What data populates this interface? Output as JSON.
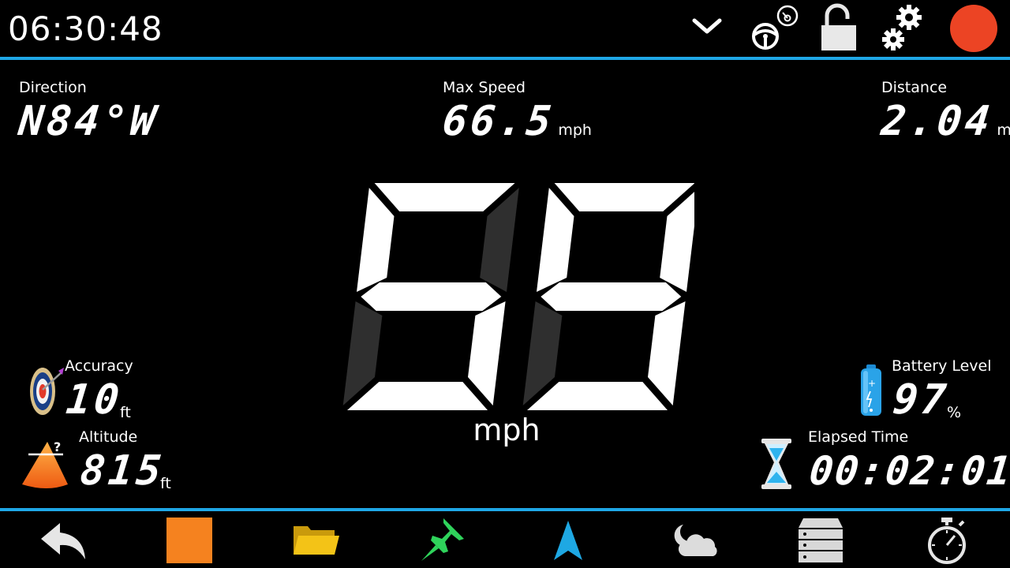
{
  "status": {
    "clock": "06:30:48"
  },
  "colors": {
    "accent": "#1fa7e6",
    "record": "#ec4424",
    "stop": "#f5821f",
    "folder": "#f3c317",
    "pin": "#2fd35b",
    "nav_arrow": "#1ea8e3",
    "dim_segment": "#2f2f2f"
  },
  "top_icons": [
    "chevron-down-icon",
    "steering-wheel-icon",
    "unlock-icon",
    "gears-icon",
    "record-icon"
  ],
  "direction": {
    "label": "Direction",
    "value": "N84°W"
  },
  "max_speed": {
    "label": "Max Speed",
    "value": "66.5",
    "unit": "mph"
  },
  "distance": {
    "label": "Distance",
    "value": "2.04",
    "unit": "mi"
  },
  "speed": {
    "value": "59",
    "unit": "mph"
  },
  "accuracy": {
    "label": "Accuracy",
    "value": "10",
    "unit": "ft"
  },
  "altitude": {
    "label": "Altitude",
    "value": "815",
    "unit": "ft"
  },
  "battery": {
    "label": "Battery Level",
    "value": "97",
    "unit": "%"
  },
  "elapsed": {
    "label": "Elapsed Time",
    "value": "00:02:01"
  },
  "nav_icons": [
    "back-icon",
    "stop-icon",
    "folder-icon",
    "pin-icon",
    "navigation-arrow-icon",
    "weather-icon",
    "storage-icon",
    "stopwatch-icon"
  ]
}
